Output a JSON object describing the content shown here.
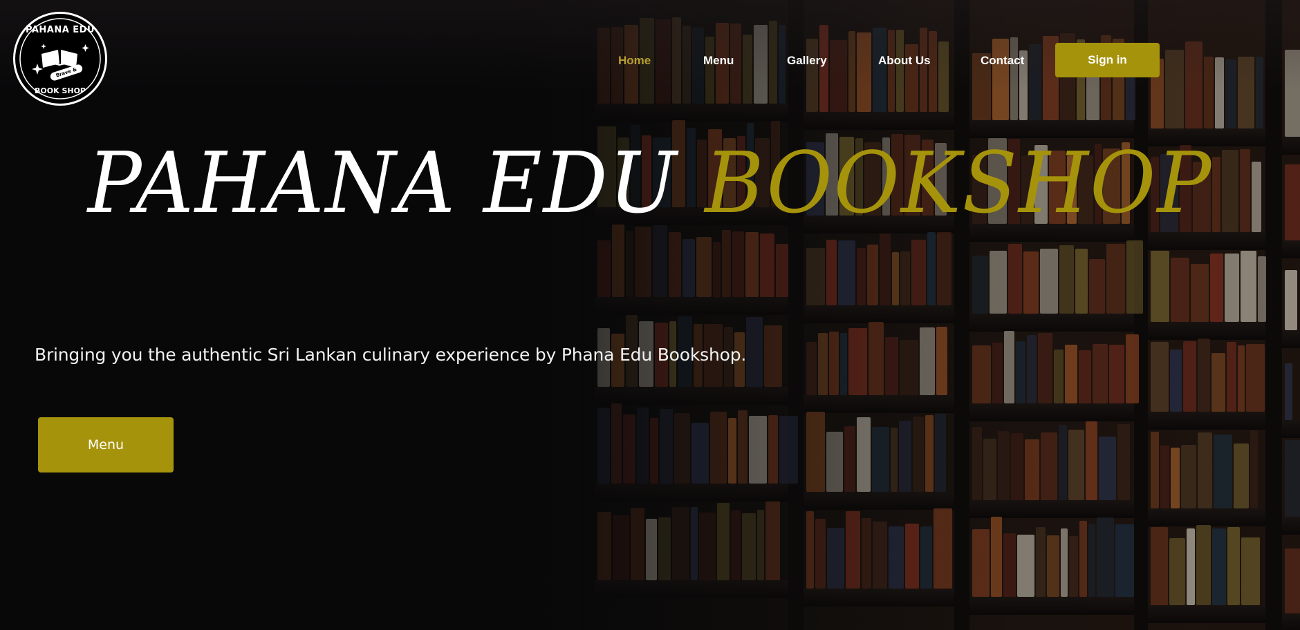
{
  "logo": {
    "top_text": "PAHANA EDU",
    "badge_text": "Brave & Great",
    "bottom_text": "BOOK SHOP"
  },
  "nav": {
    "items": [
      {
        "label": "Home",
        "active": true
      },
      {
        "label": "Menu",
        "active": false
      },
      {
        "label": "Gallery",
        "active": false
      },
      {
        "label": "About Us",
        "active": false
      },
      {
        "label": "Contact",
        "active": false
      }
    ],
    "signin_label": "Sign in"
  },
  "hero": {
    "title_part1": "PAHANA EDU",
    "title_part2": "BOOKSHOP",
    "tagline": "Bringing you the authentic Sri Lankan culinary experience by Phana Edu Bookshop.",
    "cta_label": "Menu"
  },
  "colors": {
    "accent": "#a6930c",
    "active_nav": "#b5a130",
    "background": "#0a0a0b",
    "text": "#ffffff"
  }
}
